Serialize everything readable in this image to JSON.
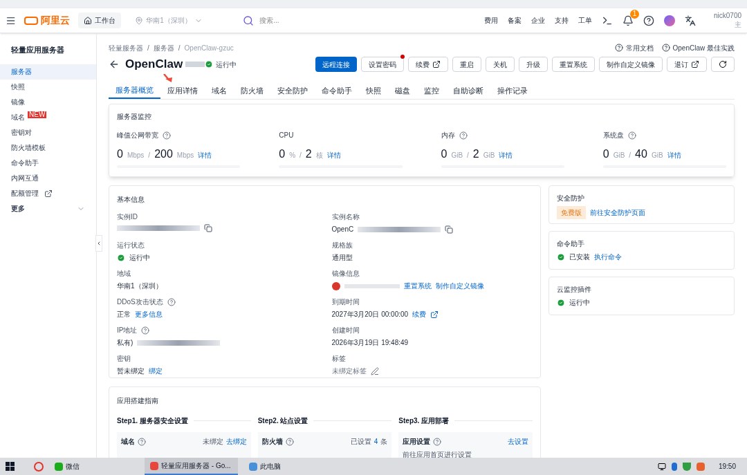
{
  "topbar": {
    "logo": "阿里云",
    "workbench": "工作台",
    "region": "华南1（深圳）",
    "search_placeholder": "搜索...",
    "links": [
      "费用",
      "备案",
      "企业",
      "支持",
      "工单"
    ],
    "notification_count": "1",
    "user": "nick0700",
    "user_sub": "主"
  },
  "sidebar": {
    "title": "轻量应用服务器",
    "items": [
      {
        "label": "服务器",
        "kind": "item",
        "selected": true
      },
      {
        "label": "快照",
        "kind": "item",
        "selected": false
      },
      {
        "label": "镜像",
        "kind": "item",
        "selected": false
      },
      {
        "label": "域名",
        "kind": "item",
        "selected": false,
        "badge": "NEW"
      },
      {
        "label": "密钥对",
        "kind": "item",
        "selected": false
      },
      {
        "label": "防火墙模板",
        "kind": "item",
        "selected": false
      },
      {
        "label": "命令助手",
        "kind": "item",
        "selected": false
      },
      {
        "label": "内网互通",
        "kind": "item",
        "selected": false
      },
      {
        "label": "配额管理",
        "kind": "external",
        "selected": false
      },
      {
        "label": "更多",
        "kind": "group",
        "selected": false
      }
    ]
  },
  "breadcrumb": [
    "轻量服务器",
    "服务器",
    "OpenClaw-gzuc"
  ],
  "breadcrumb_separator": "/",
  "help_links": [
    "常用文档",
    "OpenClaw 最佳实践"
  ],
  "title": "OpenClaw",
  "status": "运行中",
  "actions": [
    {
      "label": "远程连接",
      "kind": "primary"
    },
    {
      "label": "设置密码",
      "kind": "dot"
    },
    {
      "label": "续费",
      "kind": "external"
    },
    {
      "label": "重启",
      "kind": "default"
    },
    {
      "label": "关机",
      "kind": "default"
    },
    {
      "label": "升级",
      "kind": "default"
    },
    {
      "label": "重置系统",
      "kind": "default"
    },
    {
      "label": "制作自定义镜像",
      "kind": "default"
    },
    {
      "label": "退订",
      "kind": "external"
    },
    {
      "kind": "refresh"
    }
  ],
  "tabs": [
    {
      "label": "服务器概览",
      "selected": true
    },
    {
      "label": "应用详情",
      "selected": false
    },
    {
      "label": "域名",
      "selected": false
    },
    {
      "label": "防火墙",
      "selected": false
    },
    {
      "label": "安全防护",
      "selected": false
    },
    {
      "label": "命令助手",
      "selected": false
    },
    {
      "label": "快照",
      "selected": false
    },
    {
      "label": "磁盘",
      "selected": false
    },
    {
      "label": "监控",
      "selected": false
    },
    {
      "label": "自助诊断",
      "selected": false
    },
    {
      "label": "操作记录",
      "selected": false
    }
  ],
  "monitor": {
    "title": "服务器监控",
    "separator": "/",
    "metrics": [
      {
        "label": "峰值公网带宽",
        "help": true,
        "used": "0",
        "used_unit": "Mbps",
        "total": "200",
        "total_unit": "Mbps",
        "link": "详情",
        "level": 0
      },
      {
        "label": "CPU",
        "used": "0",
        "used_unit": "%",
        "total": "2",
        "total_unit": "核",
        "link": "详情",
        "level": 0
      },
      {
        "label": "内存",
        "help": true,
        "used": "0",
        "used_unit": "GiB",
        "total": "2",
        "total_unit": "GiB",
        "link": "详情",
        "level": 0
      },
      {
        "label": "系统盘",
        "help": true,
        "used": "0",
        "used_unit": "GiB",
        "total": "40",
        "total_unit": "GiB",
        "link": "详情",
        "level": 0
      }
    ]
  },
  "basic_info": {
    "title": "基本信息",
    "columns": [
      [
        {
          "label": "实例ID",
          "kind": "redacted",
          "copy": true
        },
        {
          "label": "运行状态",
          "kind": "status",
          "value": "运行中"
        },
        {
          "label": "地域",
          "kind": "text",
          "value": "华南1（深圳）"
        },
        {
          "label": "DDoS攻击状态",
          "help": true,
          "kind": "text",
          "value": "正常",
          "links": [
            "更多信息"
          ]
        },
        {
          "label": "IP地址",
          "help": true,
          "kind": "redacted",
          "value": "私有)"
        },
        {
          "label": "密钥",
          "kind": "text",
          "value": "暂未绑定",
          "links": [
            "绑定"
          ]
        }
      ],
      [
        {
          "label": "实例名称",
          "kind": "redacted",
          "value": "OpenC",
          "copy": true
        },
        {
          "label": "规格族",
          "kind": "text",
          "value": "通用型"
        },
        {
          "label": "镜像信息",
          "kind": "image",
          "links": [
            "重置系统",
            "制作自定义镜像"
          ]
        },
        {
          "label": "到期时间",
          "kind": "text",
          "value": "2027年3月20日 00:00:00",
          "links": [
            "续费"
          ],
          "external": true
        },
        {
          "label": "创建时间",
          "kind": "text",
          "value": "2026年3月19日 19:48:49"
        },
        {
          "label": "标签",
          "kind": "muted",
          "value": "未绑定标签",
          "edit": true
        }
      ]
    ]
  },
  "side_cards": [
    {
      "title": "安全防护",
      "badge": "免费版",
      "link": "前往安全防护页面"
    },
    {
      "title": "命令助手",
      "status": "已安装",
      "link": "执行命令"
    },
    {
      "title": "云监控插件",
      "status": "运行中"
    }
  ],
  "guide": {
    "title": "应用搭建指南",
    "steps": [
      {
        "title": "Step1. 服务器安全设置",
        "item": "域名",
        "state": "未绑定",
        "link": "去绑定"
      },
      {
        "title": "Step2. 站点设置",
        "item": "防火墙",
        "state": "已设置",
        "count": "4",
        "unit": "条"
      },
      {
        "title": "Step3. 应用部署",
        "item": "应用设置",
        "link": "去设置",
        "note": "前往应用首页进行设置"
      }
    ]
  },
  "taskbar": {
    "apps": [
      {
        "label": "微信",
        "selected": false
      },
      {
        "label": "轻量应用服务器 - Go...",
        "selected": true
      },
      {
        "label": "此电脑",
        "selected": false
      }
    ],
    "time": "19:50"
  }
}
